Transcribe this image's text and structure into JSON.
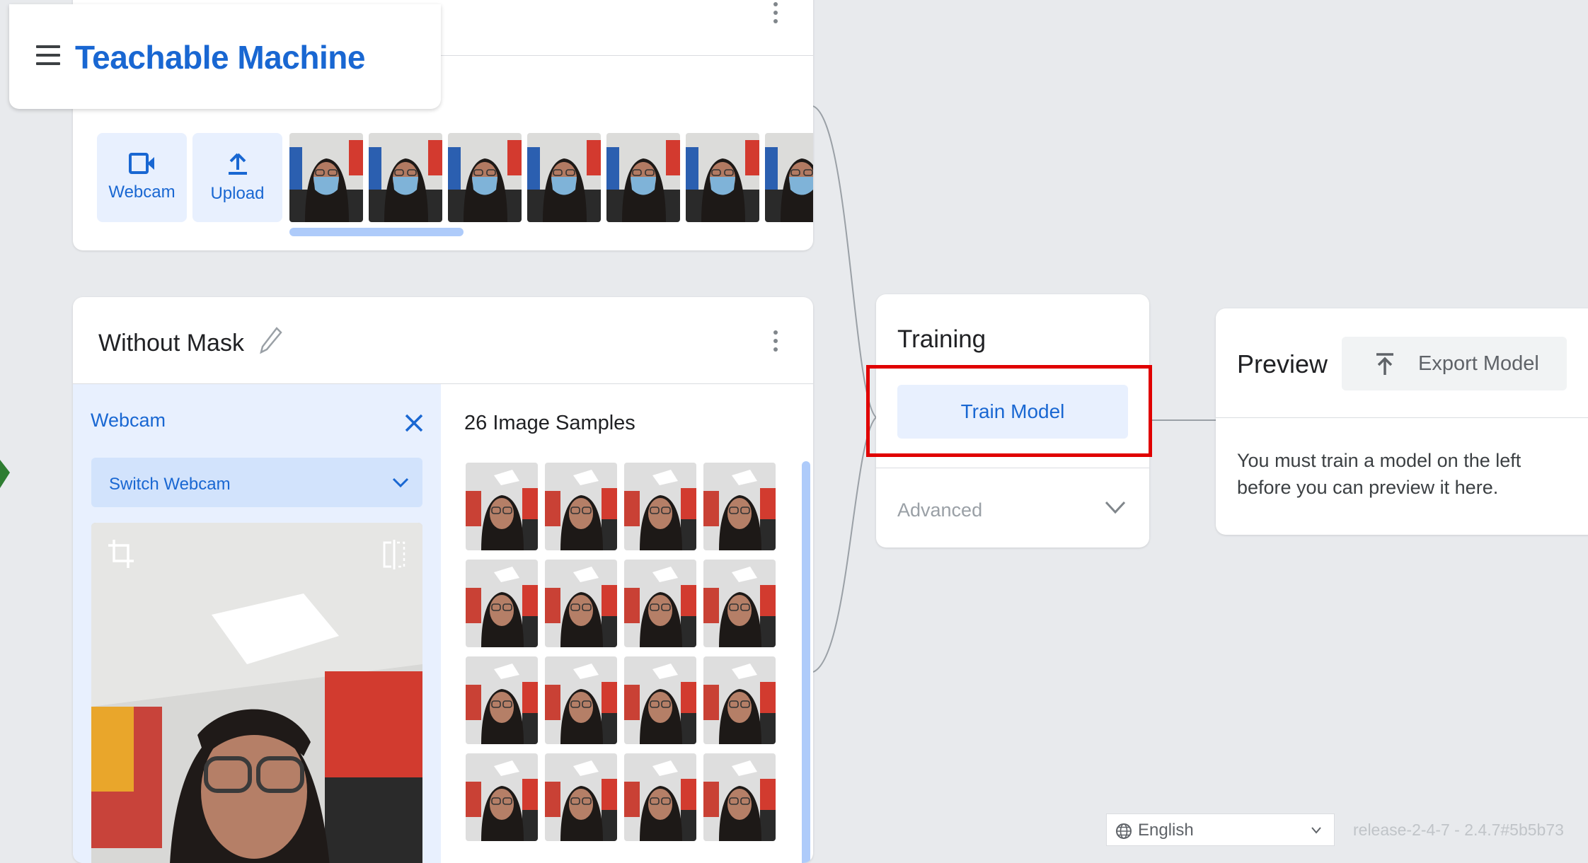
{
  "header": {
    "title": "Teachable Machine"
  },
  "class1": {
    "source_buttons": [
      {
        "label": "Webcam",
        "icon": "webcam-icon"
      },
      {
        "label": "Upload",
        "icon": "upload-icon"
      }
    ],
    "visible_thumbnails": 7
  },
  "class2": {
    "name": "Without Mask",
    "webcam": {
      "title": "Webcam",
      "switch_label": "Switch Webcam"
    },
    "samples_label": "26 Image Samples",
    "visible_thumbnails": 16
  },
  "training": {
    "title": "Training",
    "train_button": "Train Model",
    "advanced_label": "Advanced"
  },
  "preview": {
    "title": "Preview",
    "export_button": "Export Model",
    "message": "You must train a model on the left before you can preview it here."
  },
  "footer": {
    "language": "English",
    "release": "release-2-4-7 - 2.4.7#5b5b73"
  },
  "colors": {
    "accent": "#1967d2",
    "highlight": "#e00000",
    "panel_blue": "#e8f0fe"
  }
}
